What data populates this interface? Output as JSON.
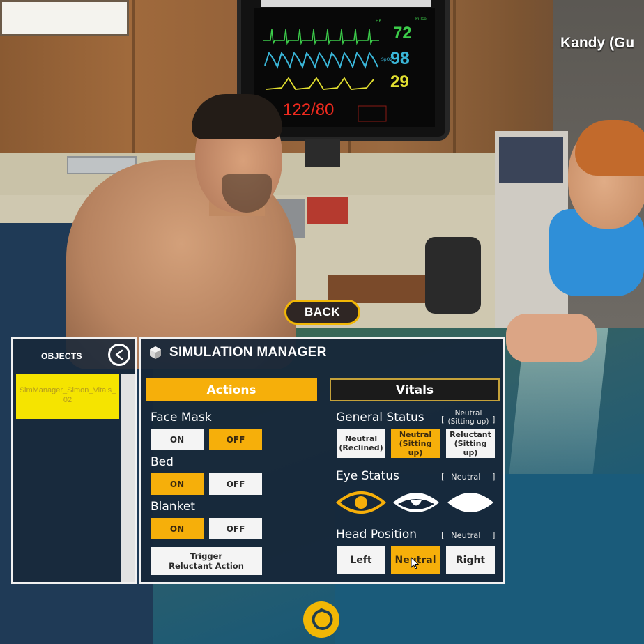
{
  "scene": {
    "monitor": {
      "heart_rate": "72",
      "spo2": "98",
      "resp_rate": "29",
      "blood_pressure": "122/80",
      "hr_label": "Pulse"
    },
    "character_name": "Kandy (Gu",
    "back_button": "BACK"
  },
  "objects_panel": {
    "title": "OBJECTS",
    "items": [
      {
        "label_line1": "SimManager_Simon_Vitals_",
        "label_line2": "02",
        "selected": true
      }
    ]
  },
  "sim_manager": {
    "title": "SIMULATION MANAGER",
    "tabs": [
      {
        "label": "Actions",
        "active": true
      },
      {
        "label": "Vitals",
        "active": false
      }
    ],
    "actions": {
      "face_mask": {
        "label": "Face Mask",
        "on": "ON",
        "off": "OFF",
        "selected": "OFF"
      },
      "bed": {
        "label": "Bed",
        "on": "ON",
        "off": "OFF",
        "selected": "ON"
      },
      "blanket": {
        "label": "Blanket",
        "on": "ON",
        "off": "OFF",
        "selected": "ON"
      },
      "trigger": {
        "line1": "Trigger",
        "line2": "Reluctant Action"
      }
    },
    "vitals": {
      "general_status": {
        "label": "General Status",
        "current_line1": "Neutral",
        "current_line2": "(Sitting up)",
        "options": [
          {
            "line1": "Neutral",
            "line2": "(Reclined)",
            "selected": false
          },
          {
            "line1": "Neutral",
            "line2": "(Sitting up)",
            "selected": true
          },
          {
            "line1": "Reluctant",
            "line2": "(Sitting up)",
            "selected": false
          }
        ]
      },
      "eye_status": {
        "label": "Eye Status",
        "current": "Neutral",
        "options": [
          {
            "icon": "eye-open-icon",
            "selected": true
          },
          {
            "icon": "eye-half-closed-icon",
            "selected": false
          },
          {
            "icon": "eye-closed-icon",
            "selected": false
          }
        ]
      },
      "head_position": {
        "label": "Head Position",
        "current": "Neutral",
        "options": [
          {
            "label": "Left",
            "selected": false
          },
          {
            "label": "Neutral",
            "selected": true
          },
          {
            "label": "Right",
            "selected": false
          }
        ]
      }
    }
  },
  "colors": {
    "accent": "#f6af0a",
    "object_selected": "#f5e400",
    "panel_bg": "#16263a",
    "hr": "#3ccc4a",
    "spo2": "#3ab6d8",
    "rr": "#e3e030",
    "bp": "#ee2a1e"
  }
}
